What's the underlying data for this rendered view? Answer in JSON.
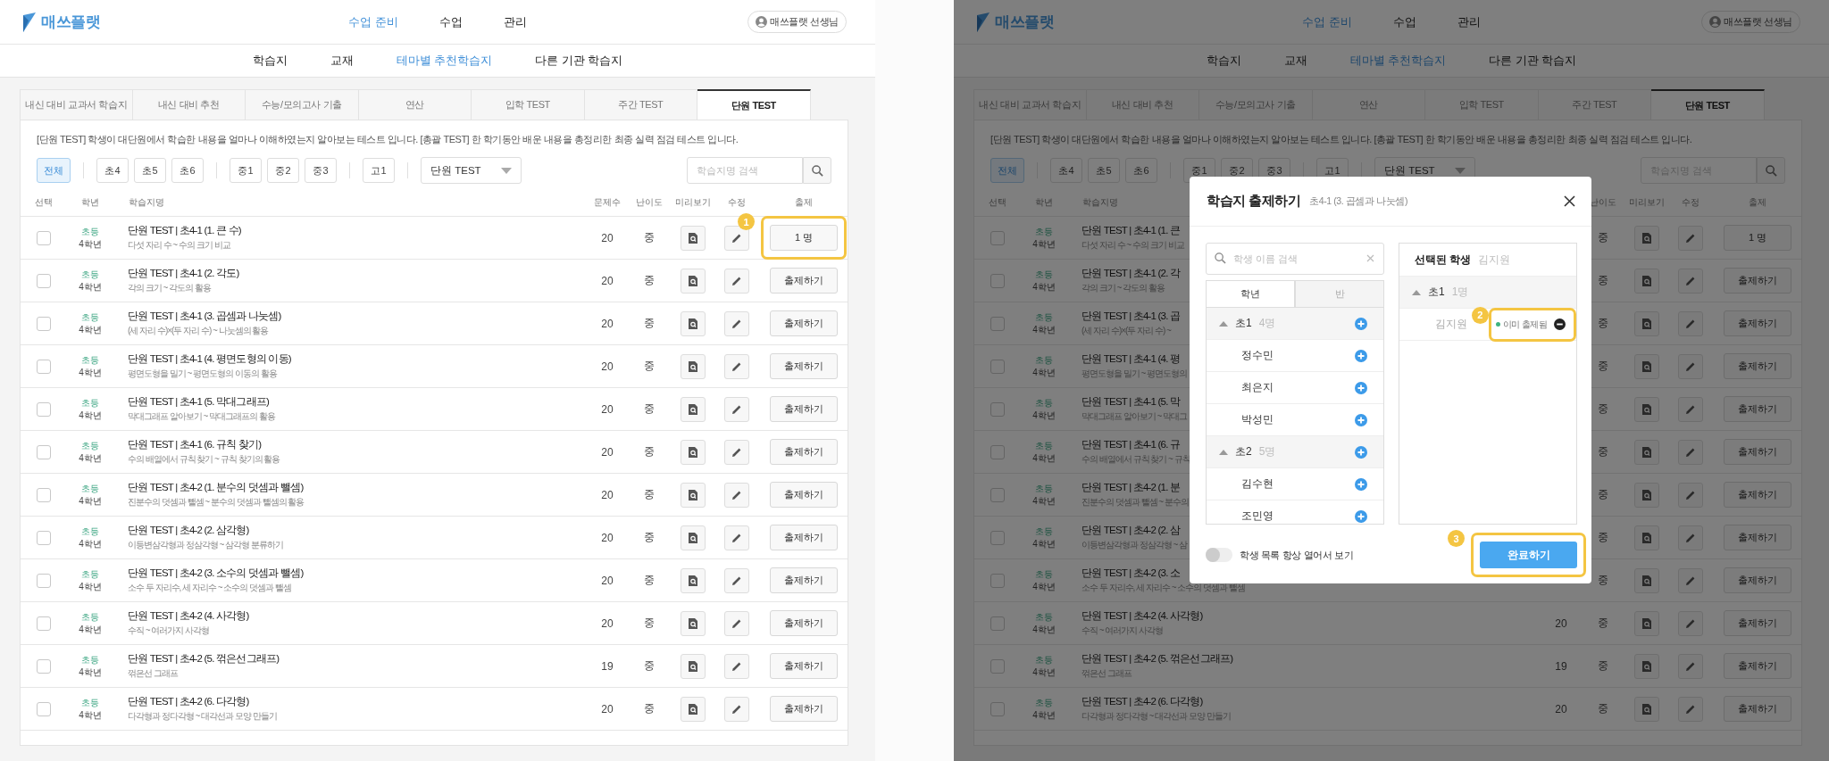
{
  "screens": [
    {
      "header": {
        "logo": "매쓰플랫",
        "nav": [
          {
            "label": "수업 준비",
            "selected": true
          },
          {
            "label": "수업",
            "selected": false
          },
          {
            "label": "관리",
            "selected": false
          }
        ],
        "user": "매쓰플랫 선생님"
      },
      "subnav": [
        {
          "label": "학습지",
          "selected": false
        },
        {
          "label": "교재",
          "selected": false
        },
        {
          "label": "테마별 추천학습지",
          "selected": true
        },
        {
          "label": "다른 기관 학습지",
          "selected": false
        }
      ],
      "tabs": [
        {
          "label": "내신 대비 교과서 학습지",
          "selected": false
        },
        {
          "label": "내신 대비 추천",
          "selected": false
        },
        {
          "label": "수능/모의고사 기출",
          "selected": false
        },
        {
          "label": "연산",
          "selected": false
        },
        {
          "label": "입학 TEST",
          "selected": false
        },
        {
          "label": "주간 TEST",
          "selected": false
        },
        {
          "label": "단원 TEST",
          "selected": true
        }
      ],
      "description": "[단원 TEST] 학생이 대단원에서 학습한 내용을 얼마나 이해하였는지 알아보는 테스트 입니다. [총괄 TEST] 한 학기동안 배운 내용을 총정리한 최종 실력 점검 테스트 입니다.",
      "filter_groups": [
        [
          {
            "label": "전체",
            "selected": true
          }
        ],
        [
          {
            "label": "초4",
            "selected": false
          },
          {
            "label": "초5",
            "selected": false
          },
          {
            "label": "초6",
            "selected": false
          }
        ],
        [
          {
            "label": "중1",
            "selected": false
          },
          {
            "label": "중2",
            "selected": false
          },
          {
            "label": "중3",
            "selected": false
          }
        ],
        [
          {
            "label": "고1",
            "selected": false
          }
        ]
      ],
      "dropdown": {
        "value": "단원 TEST"
      },
      "search": {
        "placeholder": "학습지명 검색"
      },
      "table": {
        "columns": [
          {
            "label": "선택"
          },
          {
            "label": "학년"
          },
          {
            "label": "학습지명"
          },
          {
            "label": "문제수"
          },
          {
            "label": "난이도"
          },
          {
            "label": "미리보기"
          },
          {
            "label": "수정"
          },
          {
            "label": "출제"
          }
        ],
        "rows": [
          {
            "checked": false,
            "level": "초등",
            "grade": "4학년",
            "title": "단원 TEST | 초4-1 (1. 큰 수)",
            "subtitle": "다섯 자리 수 ~ 수의 크기 비교",
            "count": "20",
            "difficulty": "중",
            "action": "1 명",
            "callout": "1"
          },
          {
            "checked": false,
            "level": "초등",
            "grade": "4학년",
            "title": "단원 TEST | 초4-1 (2. 각도)",
            "subtitle": "각의 크기 ~ 각도의 활용",
            "count": "20",
            "difficulty": "중",
            "action": "출제하기"
          },
          {
            "checked": false,
            "level": "초등",
            "grade": "4학년",
            "title": "단원 TEST | 초4-1 (3. 곱셈과 나눗셈)",
            "subtitle": "(세 자리 수)×(두 자리 수) ~ 나눗셈의 활용",
            "count": "20",
            "difficulty": "중",
            "action": "출제하기"
          },
          {
            "checked": false,
            "level": "초등",
            "grade": "4학년",
            "title": "단원 TEST | 초4-1 (4. 평면도형의 이동)",
            "subtitle": "평면도형을 밀기 ~ 평면도형의 이동의 활용",
            "count": "20",
            "difficulty": "중",
            "action": "출제하기"
          },
          {
            "checked": false,
            "level": "초등",
            "grade": "4학년",
            "title": "단원 TEST | 초4-1 (5. 막대그래프)",
            "subtitle": "막대그래프 알아보기 ~ 막대그래프의 활용",
            "count": "20",
            "difficulty": "중",
            "action": "출제하기"
          },
          {
            "checked": false,
            "level": "초등",
            "grade": "4학년",
            "title": "단원 TEST | 초4-1 (6. 규칙 찾기)",
            "subtitle": "수의 배열에서 규칙 찾기 ~ 규칙 찾기의 활용",
            "count": "20",
            "difficulty": "중",
            "action": "출제하기"
          },
          {
            "checked": false,
            "level": "초등",
            "grade": "4학년",
            "title": "단원 TEST | 초4-2 (1. 분수의 덧셈과 뺄셈)",
            "subtitle": "진분수의 덧셈과 뺄셈 ~ 분수의 덧셈과 뺄셈의 활용",
            "count": "20",
            "difficulty": "중",
            "action": "출제하기"
          },
          {
            "checked": false,
            "level": "초등",
            "grade": "4학년",
            "title": "단원 TEST | 초4-2 (2. 삼각형)",
            "subtitle": "이등변삼각형과 정삼각형 ~ 삼각형 분류하기",
            "count": "20",
            "difficulty": "중",
            "action": "출제하기"
          },
          {
            "checked": false,
            "level": "초등",
            "grade": "4학년",
            "title": "단원 TEST | 초4-2 (3. 소수의 덧셈과 뺄셈)",
            "subtitle": "소수 두 자리수, 세 자리수 ~ 소수의 덧셈과 뺄셈",
            "count": "20",
            "difficulty": "중",
            "action": "출제하기"
          },
          {
            "checked": false,
            "level": "초등",
            "grade": "4학년",
            "title": "단원 TEST | 초4-2 (4. 사각형)",
            "subtitle": "수직 ~ 여러가지 사각형",
            "count": "20",
            "difficulty": "중",
            "action": "출제하기"
          },
          {
            "checked": false,
            "level": "초등",
            "grade": "4학년",
            "title": "단원 TEST | 초4-2 (5. 꺾은선그래프)",
            "subtitle": "꺾은선 그래프",
            "count": "19",
            "difficulty": "중",
            "action": "출제하기"
          },
          {
            "checked": false,
            "level": "초등",
            "grade": "4학년",
            "title": "단원 TEST | 초4-2 (6. 다각형)",
            "subtitle": "다각형과 정다각형 ~ 대각선과 모양 만들기",
            "count": "20",
            "difficulty": "중",
            "action": "출제하기"
          }
        ]
      }
    },
    {
      "header": {
        "logo": "매쓰플랫",
        "nav": [
          {
            "label": "수업 준비",
            "selected": true
          },
          {
            "label": "수업",
            "selected": false
          },
          {
            "label": "관리",
            "selected": false
          }
        ],
        "user": "매쓰플랫 선생님"
      },
      "subnav": [
        {
          "label": "학습지",
          "selected": false
        },
        {
          "label": "교재",
          "selected": false
        },
        {
          "label": "테마별 추천학습지",
          "selected": true
        },
        {
          "label": "다른 기관 학습지",
          "selected": false
        }
      ],
      "tabs": [
        {
          "label": "내신 대비 교과서 학습지",
          "selected": false
        },
        {
          "label": "내신 대비 추천",
          "selected": false
        },
        {
          "label": "수능/모의고사 기출",
          "selected": false
        },
        {
          "label": "연산",
          "selected": false
        },
        {
          "label": "입학 TEST",
          "selected": false
        },
        {
          "label": "주간 TEST",
          "selected": false
        },
        {
          "label": "단원 TEST",
          "selected": true
        }
      ],
      "description": "[단원 TEST] 학생이 대단원에서 학습한 내용을 얼마나 이해하였는지 알아보는 테스트 입니다. [총괄 TEST] 한 학기동안 배운 내용을 총정리한 최종 실력 점검 테스트 입니다.",
      "filter_groups": [
        [
          {
            "label": "전체",
            "selected": true
          }
        ],
        [
          {
            "label": "초4",
            "selected": false
          },
          {
            "label": "초5",
            "selected": false
          },
          {
            "label": "초6",
            "selected": false
          }
        ],
        [
          {
            "label": "중1",
            "selected": false
          },
          {
            "label": "중2",
            "selected": false
          },
          {
            "label": "중3",
            "selected": false
          }
        ],
        [
          {
            "label": "고1",
            "selected": false
          }
        ]
      ],
      "dropdown": {
        "value": "단원 TEST"
      },
      "search": {
        "placeholder": "학습지명 검색"
      },
      "table": {
        "columns": [
          {
            "label": "선택"
          },
          {
            "label": "학년"
          },
          {
            "label": "학습지명"
          },
          null,
          {
            "label": "난이도"
          },
          {
            "label": "미리보기"
          },
          {
            "label": "수정"
          },
          {
            "label": "출제"
          }
        ],
        "rows": [
          {
            "checked": false,
            "level": "초등",
            "grade": "4학년",
            "title": "단원 TEST | 초4-1 (1. 큰",
            "subtitle": "다섯 자리 수 ~ 수의 크기 비교",
            "difficulty": "중",
            "action": "1 명"
          },
          {
            "checked": false,
            "level": "초등",
            "grade": "4학년",
            "title": "단원 TEST | 초4-1 (2. 각",
            "subtitle": "각의 크기 ~ 각도의 활용",
            "difficulty": "중",
            "action": "출제하기"
          },
          {
            "checked": false,
            "level": "초등",
            "grade": "4학년",
            "title": "단원 TEST | 초4-1 (3. 곱",
            "subtitle": "(세 자리 수)×(두 자리 수) ~",
            "difficulty": "중",
            "action": "출제하기"
          },
          {
            "checked": false,
            "level": "초등",
            "grade": "4학년",
            "title": "단원 TEST | 초4-1 (4. 평",
            "subtitle": "평면도형을 밀기 ~ 평면도형의",
            "difficulty": "중",
            "action": "출제하기"
          },
          {
            "checked": false,
            "level": "초등",
            "grade": "4학년",
            "title": "단원 TEST | 초4-1 (5. 막",
            "subtitle": "막대그래프 알아보기 ~ 막대그",
            "difficulty": "중",
            "action": "출제하기"
          },
          {
            "checked": false,
            "level": "초등",
            "grade": "4학년",
            "title": "단원 TEST | 초4-1 (6. 규",
            "subtitle": "수의 배열에서 규칙 찾기 ~ 규칙",
            "difficulty": "중",
            "action": "출제하기"
          },
          {
            "checked": false,
            "level": "초등",
            "grade": "4학년",
            "title": "단원 TEST | 초4-2 (1. 분",
            "subtitle": "진분수의 덧셈과 뺄셈 ~ 분수의",
            "difficulty": "중",
            "action": "출제하기"
          },
          {
            "checked": false,
            "level": "초등",
            "grade": "4학년",
            "title": "단원 TEST | 초4-2 (2. 삼",
            "subtitle": "이등변삼각형과 정삼각형 ~ 삼",
            "difficulty": "중",
            "action": "출제하기"
          },
          {
            "checked": false,
            "level": "초등",
            "grade": "4학년",
            "title": "단원 TEST | 초4-2 (3. 소",
            "subtitle": "소수 두 자리수, 세 자리수 ~ 소수의 덧셈과 뺄셈",
            "difficulty": "중",
            "action": "출제하기"
          },
          {
            "checked": false,
            "level": "초등",
            "grade": "4학년",
            "title": "단원 TEST | 초4-2 (4. 사각형)",
            "subtitle": "수직 ~ 여러가지 사각형",
            "count": "20",
            "difficulty": "중",
            "action": "출제하기"
          },
          {
            "checked": false,
            "level": "초등",
            "grade": "4학년",
            "title": "단원 TEST | 초4-2 (5. 꺾은선그래프)",
            "subtitle": "꺾은선 그래프",
            "count": "19",
            "difficulty": "중",
            "action": "출제하기"
          },
          {
            "checked": false,
            "level": "초등",
            "grade": "4학년",
            "title": "단원 TEST | 초4-2 (6. 다각형)",
            "subtitle": "다각형과 정다각형 ~ 대각선과 모양 만들기",
            "count": "20",
            "difficulty": "중",
            "action": "출제하기"
          }
        ]
      },
      "modal": {
        "title": "학습지 출제하기",
        "subtitle": "초4-1 (3. 곱셈과 나눗셈)",
        "search": {
          "placeholder": "학생 이름 검색"
        },
        "tabs": [
          {
            "label": "학년",
            "selected": true
          },
          {
            "label": "반",
            "selected": false
          }
        ],
        "groups": [
          {
            "label": "초1",
            "count": "4명",
            "expanded": true,
            "children": [
              {
                "name": "정수민"
              },
              {
                "name": "최은지"
              },
              {
                "name": "박성민"
              }
            ]
          },
          {
            "label": "초2",
            "count": "5명",
            "expanded": true,
            "children": [
              {
                "name": "김수현"
              },
              {
                "name": "조민영"
              }
            ]
          }
        ],
        "selected_panel": {
          "title": "선택된 학생",
          "names": "김지원",
          "groups": [
            {
              "label": "초1",
              "count": "1명",
              "expanded": true,
              "children": [
                {
                  "name": "김지원",
                  "status": "이미 출제됨",
                  "callout": "2"
                }
              ]
            }
          ]
        },
        "toggle": {
          "label": "학생 목록 항상 열어서 보기",
          "on": false
        },
        "done_button": {
          "label": "완료하기",
          "callout": "3"
        }
      }
    }
  ]
}
